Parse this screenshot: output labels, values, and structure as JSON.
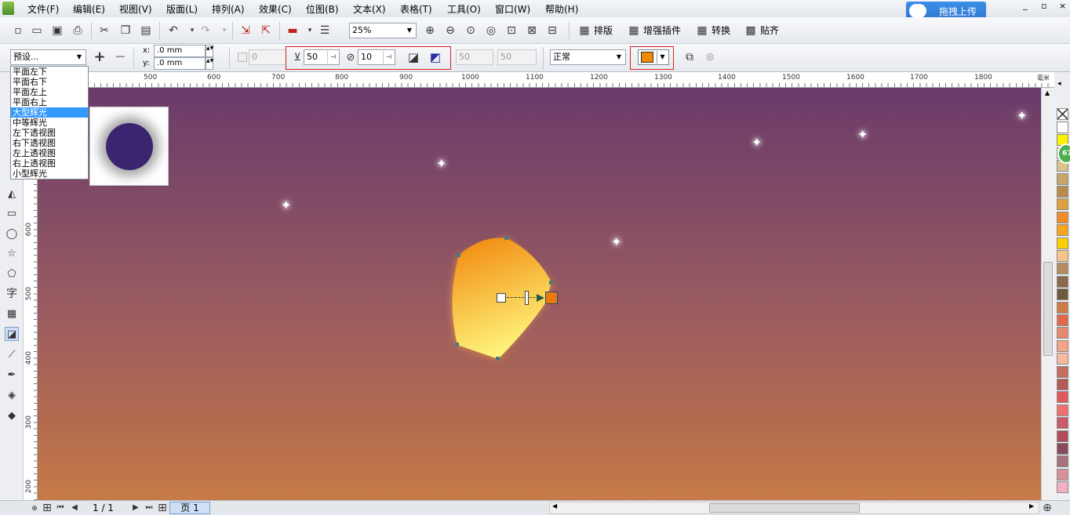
{
  "menubar": {
    "items": [
      "文件(F)",
      "编辑(E)",
      "视图(V)",
      "版面(L)",
      "排列(A)",
      "效果(C)",
      "位图(B)",
      "文本(X)",
      "表格(T)",
      "工具(O)",
      "窗口(W)",
      "帮助(H)"
    ],
    "upload_label": "拖拽上传",
    "window_controls": [
      "_",
      "▫",
      "×"
    ]
  },
  "toolbar": {
    "zoom": "25%",
    "plugins": [
      "排版",
      "增强插件",
      "转换",
      "贴齐"
    ]
  },
  "property_bar": {
    "preset": "预设...",
    "x": ".0 mm",
    "y": ".0 mm",
    "offset_value": "0",
    "opacity": "50",
    "feather": "10",
    "disabled_a": "50",
    "disabled_b": "50",
    "merge_mode": "正常",
    "shadow_color": "#f08a00"
  },
  "preset_list": {
    "items": [
      "平面左下",
      "平面右下",
      "平面左上",
      "平面右上",
      "大型辉光",
      "中等辉光",
      "左下透视图",
      "右下透视图",
      "左上透视图",
      "右上透视图",
      "小型辉光"
    ],
    "selected_index": 4
  },
  "ruler_top": {
    "unit": "毫米",
    "ticks": [
      "500",
      "600",
      "700",
      "800",
      "900",
      "1000",
      "1100",
      "1200",
      "1300",
      "1400",
      "1500",
      "1600",
      "1700",
      "1800"
    ]
  },
  "ruler_left": {
    "ticks": [
      "600",
      "500",
      "400",
      "300",
      "200"
    ]
  },
  "tools": {
    "text_tool": "字"
  },
  "status": {
    "page_count": "1 / 1",
    "page_tab": "页 1"
  },
  "palette": {
    "colors": [
      "#ffffff",
      "#fff200",
      "#fef9a7",
      "#d9c48c",
      "#c9a56a",
      "#b98c4d",
      "#e0a040",
      "#f28c28",
      "#f7a51c",
      "#fcd000",
      "#f7c58a",
      "#b58a5c",
      "#8a6a4a",
      "#6e5a3c",
      "#d27a45",
      "#e2694a",
      "#e8896d",
      "#f4a48a",
      "#f9b8a0",
      "#c86a5c",
      "#b35a55",
      "#e05a5a",
      "#f07070",
      "#c85a6a",
      "#b24a5a",
      "#8a4a5c",
      "#a8707c",
      "#d7909c",
      "#f2b0c0"
    ]
  },
  "side_badge": "67"
}
